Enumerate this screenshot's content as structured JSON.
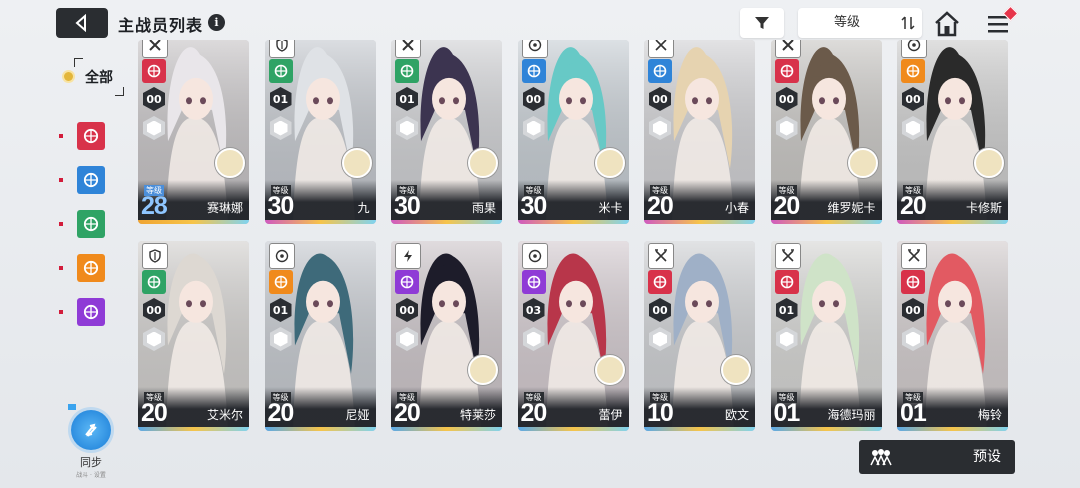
{
  "header": {
    "title": "主战员列表",
    "info_glyph": "i",
    "sort_label": "等级"
  },
  "sidebar": {
    "all_label": "全部",
    "filters": [
      {
        "name": "burst-element",
        "color": "#d8324a"
      },
      {
        "name": "balance-element",
        "color": "#2f84d8"
      },
      {
        "name": "nature-element",
        "color": "#2fa365"
      },
      {
        "name": "solar-element",
        "color": "#f08a1c"
      },
      {
        "name": "void-element",
        "color": "#8f3bd6"
      }
    ]
  },
  "sync": {
    "label": "同步",
    "sub": "战斗 · 设置"
  },
  "preset": {
    "label": "预设"
  },
  "characters": [
    {
      "name": "赛琳娜",
      "level": "28",
      "level_label": "等级",
      "rank_a": "00",
      "element": "#d8324a",
      "class": "x",
      "bg": "#c9c6c8",
      "hair": "#e9e6ea",
      "stripe": "#f0a432",
      "selected": true,
      "badge": true
    },
    {
      "name": "九",
      "level": "30",
      "level_label": "等级",
      "rank_a": "01",
      "element": "#2fa365",
      "class": "shield",
      "bg": "#c7cbd1",
      "hair": "#dfe2e6",
      "stripe": "#d05ac0",
      "selected": false,
      "badge": true
    },
    {
      "name": "雨果",
      "level": "30",
      "level_label": "等级",
      "rank_a": "01",
      "element": "#2fa365",
      "class": "x",
      "bg": "#d2d3d6",
      "hair": "#3c3450",
      "stripe": "#d05ac0",
      "selected": false,
      "badge": true
    },
    {
      "name": "米卡",
      "level": "30",
      "level_label": "等级",
      "rank_a": "00",
      "element": "#2f84d8",
      "class": "circle",
      "bg": "#c9d0d6",
      "hair": "#67c9c6",
      "stripe": "#d05ac0",
      "selected": false,
      "badge": true
    },
    {
      "name": "小春",
      "level": "20",
      "level_label": "等级",
      "rank_a": "00",
      "element": "#2f84d8",
      "class": "sword",
      "bg": "#d3d3d6",
      "hair": "#e6d3b0",
      "stripe": "#d05ac0",
      "selected": false,
      "badge": false
    },
    {
      "name": "维罗妮卡",
      "level": "20",
      "level_label": "等级",
      "rank_a": "00",
      "element": "#d8324a",
      "class": "x",
      "bg": "#cbc9c6",
      "hair": "#6b5a4a",
      "stripe": "#d05ac0",
      "selected": false,
      "badge": true
    },
    {
      "name": "卡修斯",
      "level": "20",
      "level_label": "等级",
      "rank_a": "00",
      "element": "#f08a1c",
      "class": "circle",
      "bg": "#cfcfcf",
      "hair": "#2a2a2a",
      "stripe": "#d05ac0",
      "selected": false,
      "badge": true
    },
    {
      "name": "艾米尔",
      "level": "20",
      "level_label": "等级",
      "rank_a": "00",
      "element": "#2fa365",
      "class": "shield",
      "bg": "#d4d2d0",
      "hair": "#ddd8d2",
      "stripe": "#5aa9e8",
      "selected": false,
      "badge": false
    },
    {
      "name": "尼娅",
      "level": "20",
      "level_label": "等级",
      "rank_a": "01",
      "element": "#f08a1c",
      "class": "circle",
      "bg": "#c8ccd2",
      "hair": "#3e6a7a",
      "stripe": "#5aa9e8",
      "selected": false,
      "badge": false
    },
    {
      "name": "特莱莎",
      "level": "20",
      "level_label": "等级",
      "rank_a": "00",
      "element": "#8f3bd6",
      "class": "bolt",
      "bg": "#cfc8cc",
      "hair": "#1d1c2a",
      "stripe": "#5aa9e8",
      "selected": false,
      "badge": true
    },
    {
      "name": "蕾伊",
      "level": "20",
      "level_label": "等级",
      "rank_a": "03",
      "element": "#8f3bd6",
      "class": "circle",
      "bg": "#d6cdd2",
      "hair": "#b8364a",
      "stripe": "#5aa9e8",
      "selected": false,
      "badge": true
    },
    {
      "name": "欧文",
      "level": "10",
      "level_label": "等级",
      "rank_a": "00",
      "element": "#d8324a",
      "class": "sword",
      "bg": "#d1d3d6",
      "hair": "#9fb0c7",
      "stripe": "#5aa9e8",
      "selected": false,
      "badge": true
    },
    {
      "name": "海德玛丽",
      "level": "01",
      "level_label": "等级",
      "rank_a": "01",
      "element": "#d8324a",
      "class": "sword",
      "bg": "#d8d8d6",
      "hair": "#cfe3c8",
      "stripe": "#5aa9e8",
      "selected": false,
      "badge": false
    },
    {
      "name": "梅铃",
      "level": "01",
      "level_label": "等级",
      "rank_a": "00",
      "element": "#d8324a",
      "class": "sword",
      "bg": "#d5cfd0",
      "hair": "#e25a62",
      "stripe": "#5aa9e8",
      "selected": false,
      "badge": false
    }
  ]
}
